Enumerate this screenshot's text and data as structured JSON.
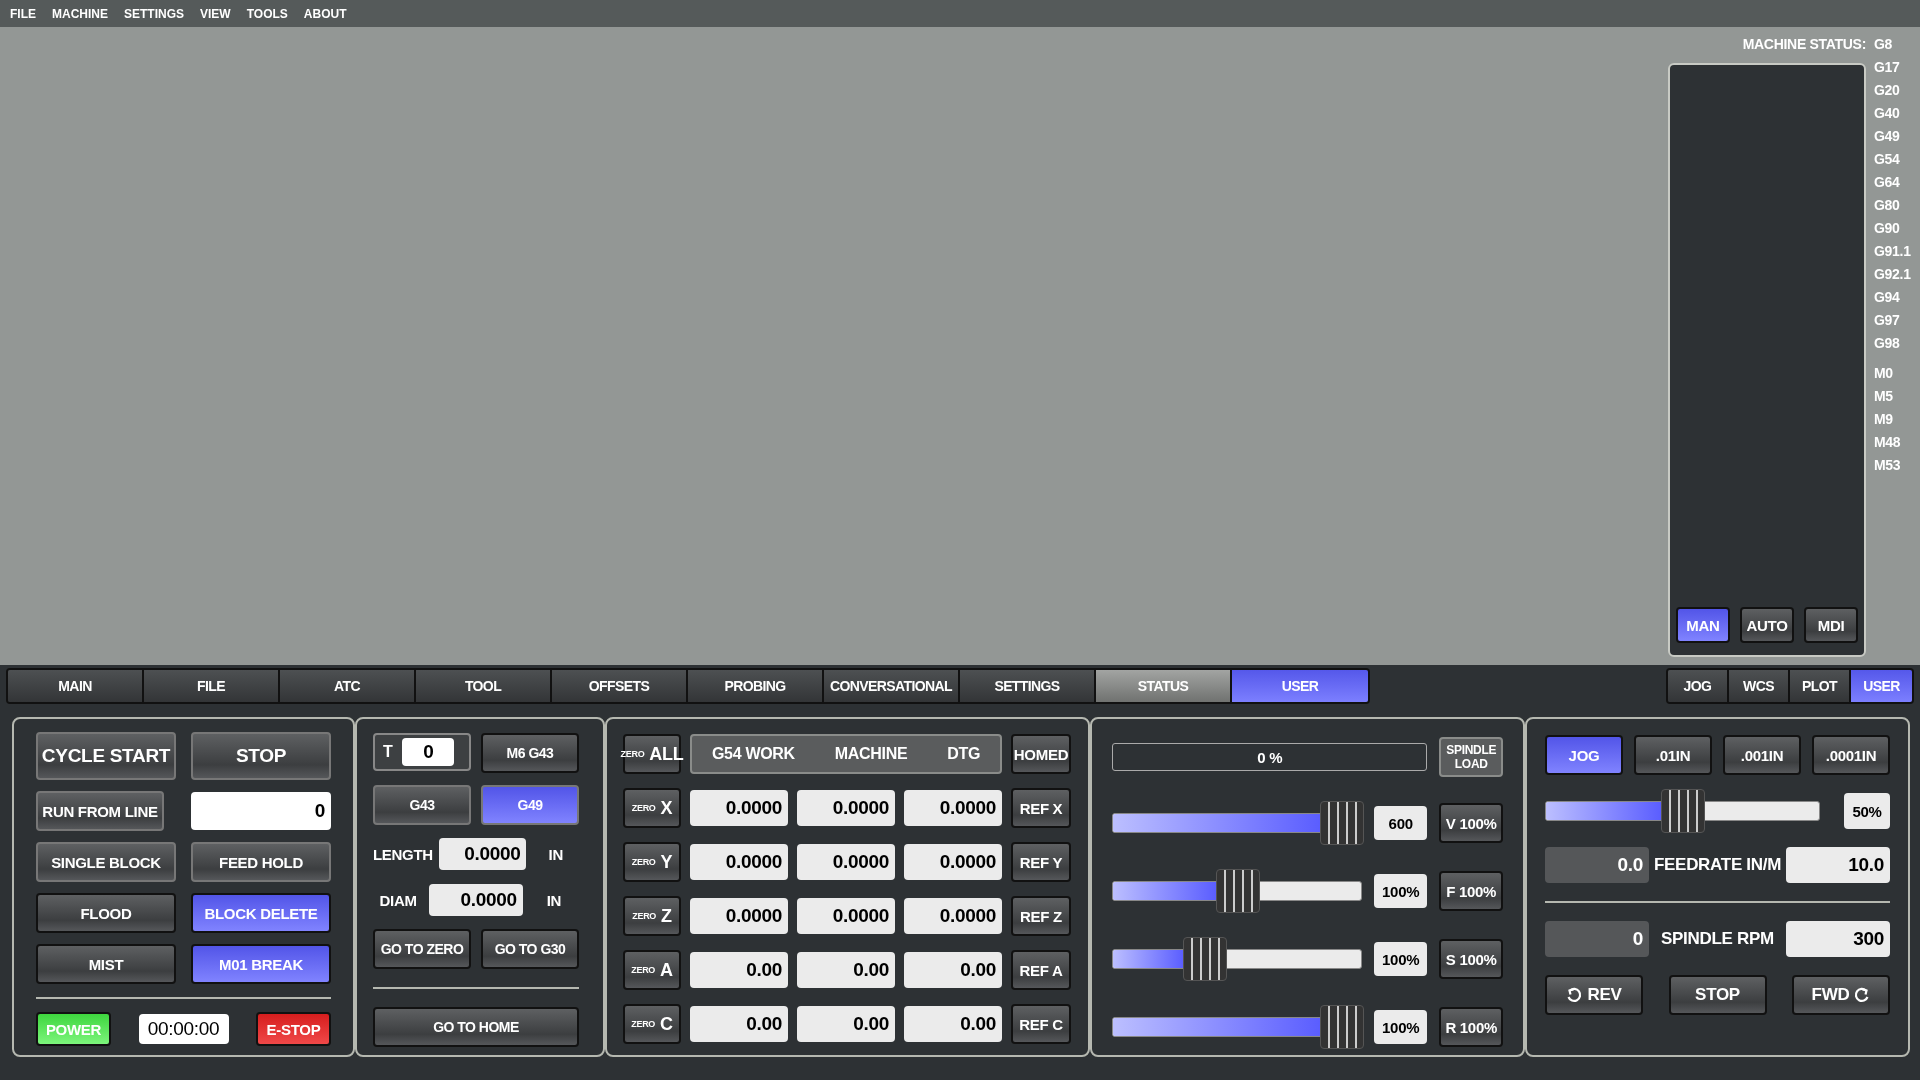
{
  "menu": [
    "FILE",
    "MACHINE",
    "SETTINGS",
    "VIEW",
    "TOOLS",
    "ABOUT"
  ],
  "status": {
    "label": "MACHINE STATUS:",
    "g_codes": [
      "G8",
      "G17",
      "G20",
      "G40",
      "G49",
      "G54",
      "G64",
      "G80",
      "G90",
      "G91.1",
      "G92.1",
      "G94",
      "G97",
      "G98"
    ],
    "m_codes": [
      "M0",
      "M5",
      "M9",
      "M48",
      "M53"
    ],
    "modes": [
      {
        "label": "MAN",
        "selected": true
      },
      {
        "label": "AUTO",
        "selected": false
      },
      {
        "label": "MDI",
        "selected": false
      }
    ]
  },
  "tabs": [
    {
      "label": "MAIN",
      "selected": false,
      "hovered": false
    },
    {
      "label": "FILE",
      "selected": false,
      "hovered": false
    },
    {
      "label": "ATC",
      "selected": false,
      "hovered": false
    },
    {
      "label": "TOOL",
      "selected": false,
      "hovered": false
    },
    {
      "label": "OFFSETS",
      "selected": false,
      "hovered": false
    },
    {
      "label": "PROBING",
      "selected": false,
      "hovered": false
    },
    {
      "label": "CONVERSATIONAL",
      "selected": false,
      "hovered": false
    },
    {
      "label": "SETTINGS",
      "selected": false,
      "hovered": false
    },
    {
      "label": "STATUS",
      "selected": false,
      "hovered": true
    },
    {
      "label": "USER",
      "selected": true,
      "hovered": false
    }
  ],
  "side_tabs": [
    {
      "label": "JOG",
      "selected": false
    },
    {
      "label": "WCS",
      "selected": false
    },
    {
      "label": "PLOT",
      "selected": false
    },
    {
      "label": "USER",
      "selected": true
    }
  ],
  "program": {
    "cycle_start": "CYCLE START",
    "stop": "STOP",
    "run_from_line": {
      "label": "RUN FROM LINE",
      "value": "0"
    },
    "toggles": [
      {
        "label": "SINGLE BLOCK",
        "on": false,
        "kind": "raised"
      },
      {
        "label": "FEED HOLD",
        "on": false,
        "kind": "raised"
      },
      {
        "label": "FLOOD",
        "on": false,
        "kind": "flat"
      },
      {
        "label": "BLOCK DELETE",
        "on": true,
        "kind": "flat"
      },
      {
        "label": "MIST",
        "on": false,
        "kind": "flat"
      },
      {
        "label": "M01 BREAK",
        "on": true,
        "kind": "flat"
      }
    ],
    "power": {
      "label": "POWER",
      "on": true
    },
    "timer": "00:00:00",
    "estop": "E-STOP"
  },
  "tool": {
    "t_label": "T",
    "t_value": "0",
    "load": "M6 G43",
    "comp": [
      {
        "label": "G43",
        "selected": false
      },
      {
        "label": "G49",
        "selected": true
      }
    ],
    "fields": [
      {
        "label": "LENGTH",
        "value": "0.0000",
        "unit": "IN"
      },
      {
        "label": "DIAM",
        "value": "0.0000",
        "unit": "IN"
      }
    ],
    "goto": [
      "GO TO ZERO",
      "GO TO G30"
    ],
    "home": "GO TO HOME"
  },
  "dro": {
    "zero_all": {
      "small": "ZERO",
      "big": "ALL"
    },
    "columns": [
      "G54 WORK",
      "MACHINE",
      "DTG"
    ],
    "homed": "HOMED",
    "axes": [
      {
        "zero_small": "ZERO",
        "axis": "X",
        "work": "0.0000",
        "machine": "0.0000",
        "dtg": "0.0000",
        "ref": "REF X"
      },
      {
        "zero_small": "ZERO",
        "axis": "Y",
        "work": "0.0000",
        "machine": "0.0000",
        "dtg": "0.0000",
        "ref": "REF Y"
      },
      {
        "zero_small": "ZERO",
        "axis": "Z",
        "work": "0.0000",
        "machine": "0.0000",
        "dtg": "0.0000",
        "ref": "REF Z"
      },
      {
        "zero_small": "ZERO",
        "axis": "A",
        "work": "0.00",
        "machine": "0.00",
        "dtg": "0.00",
        "ref": "REF A"
      },
      {
        "zero_small": "ZERO",
        "axis": "C",
        "work": "0.00",
        "machine": "0.00",
        "dtg": "0.00",
        "ref": "REF C"
      }
    ]
  },
  "overrides": {
    "spindle_load": {
      "level": 0,
      "reading": "0 %",
      "label": "SPINDLE LOAD"
    },
    "sliders": [
      {
        "level": 1,
        "reading": "600",
        "button": "V 100%"
      },
      {
        "level": 0.5,
        "reading": "100%",
        "button": "F 100%"
      },
      {
        "level": 0.34,
        "reading": "100%",
        "button": "S 100%"
      },
      {
        "level": 1,
        "reading": "100%",
        "button": "R 100%"
      }
    ]
  },
  "jog": {
    "modes": [
      {
        "label": "JOG",
        "selected": true
      },
      {
        "label": ".01IN",
        "selected": false
      },
      {
        "label": ".001IN",
        "selected": false
      },
      {
        "label": ".0001IN",
        "selected": false
      }
    ],
    "slider": {
      "level": 0.5,
      "reading": "50%"
    },
    "feed": {
      "actual": "0.0",
      "label": "FEEDRATE IN/M",
      "set": "10.0"
    },
    "spindle": {
      "actual": "0",
      "label": "SPINDLE RPM",
      "set": "300"
    },
    "spindle_buttons": [
      {
        "label": "REV",
        "kind": "rev"
      },
      {
        "label": "STOP",
        "kind": "stop"
      },
      {
        "label": "FWD",
        "kind": "fwd"
      }
    ]
  }
}
